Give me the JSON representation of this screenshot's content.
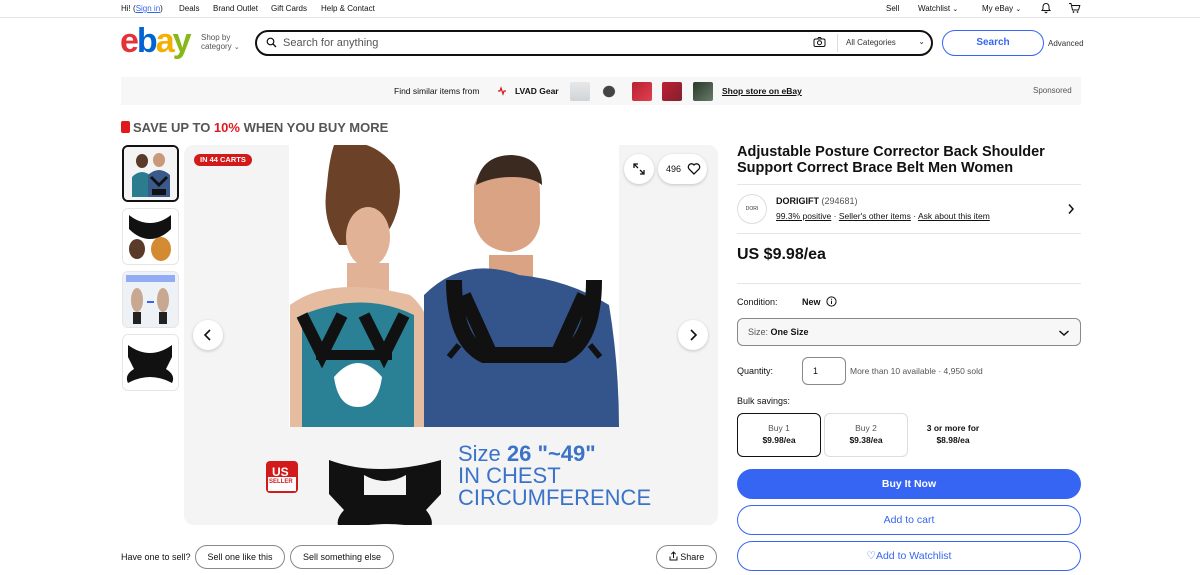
{
  "topnav": {
    "greeting": "Hi!",
    "sign_in": "Sign in",
    "greeting_close": ")",
    "greeting_open": "(",
    "deals": "Deals",
    "brand_outlet": "Brand Outlet",
    "gift_cards": "Gift Cards",
    "help": "Help & Contact",
    "sell": "Sell",
    "watchlist": "Watchlist",
    "my_ebay": "My eBay"
  },
  "header": {
    "logo": {
      "e": "e",
      "b": "b",
      "a": "a",
      "y": "y"
    },
    "shop_by": "Shop by",
    "category": "category",
    "search_placeholder": "Search for anything",
    "category_select": "All Categories",
    "search_button": "Search",
    "advanced": "Advanced"
  },
  "banner": {
    "find_similar": "Find similar items from",
    "store_name": "LVAD Gear",
    "shop_store": "Shop store on eBay",
    "sponsored": "Sponsored"
  },
  "promo": {
    "prefix": "SAVE UP TO ",
    "percent": "10%",
    "suffix": " WHEN YOU BUY MORE"
  },
  "gallery": {
    "badge": "IN 44 CARTS",
    "watch_count": "496",
    "size_line1_a": "Size ",
    "size_line1_b": "26",
    "size_line1_c": " \"~49\"",
    "size_line2": "IN CHEST",
    "size_line3": "CIRCUMFERENCE",
    "us_seller_1": "US",
    "us_seller_2": "SELLER"
  },
  "item": {
    "title": "Adjustable Posture Corrector Back Shoulder Support Correct Brace Belt Men Women",
    "seller_logo": "DORI",
    "seller_name": "DORIGIFT",
    "seller_score": "(294681)",
    "positive": "99.3% positive",
    "other_items": "Seller's other items",
    "ask": "Ask about this item",
    "price": "US $9.98/ea",
    "condition_label": "Condition:",
    "condition_value": "New",
    "size_label": "Size: ",
    "size_value": "One Size",
    "quantity_label": "Quantity:",
    "quantity_value": "1",
    "availability": "More than 10 available · 4,950 sold",
    "bulk_label": "Bulk savings:",
    "bulk": [
      {
        "qty": "Buy 1",
        "price": "$9.98/ea"
      },
      {
        "qty": "Buy 2",
        "price": "$9.38/ea"
      },
      {
        "qty": "3 or more for",
        "price": "$8.98/ea"
      }
    ],
    "buy_now": "Buy It Now",
    "add_cart": "Add to cart",
    "add_watchlist": "Add to Watchlist"
  },
  "bottom": {
    "have_one": "Have one to sell?",
    "sell_like": "Sell one like this",
    "sell_else": "Sell something else",
    "share": "Share"
  },
  "colors": {
    "accent": "#3665f3",
    "badge_red": "#d31a1a"
  }
}
